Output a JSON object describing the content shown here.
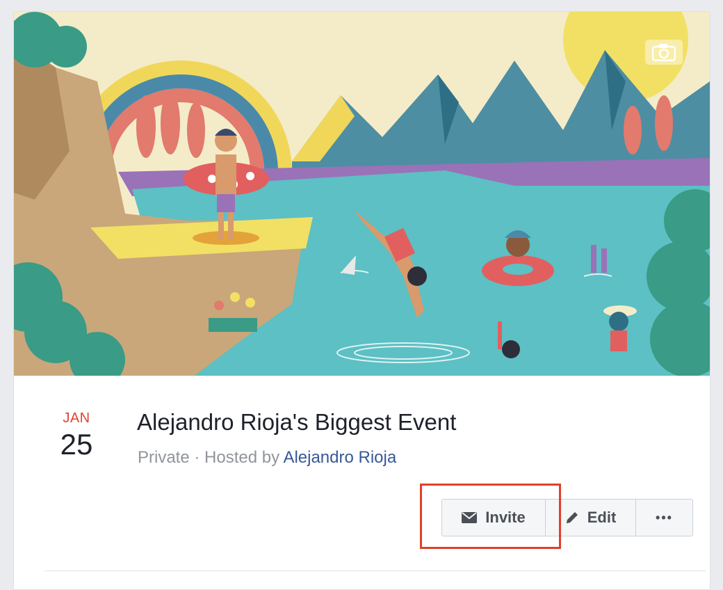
{
  "event": {
    "date_month": "JAN",
    "date_day": "25",
    "title": "Alejandro Rioja's Biggest Event",
    "privacy": "Private",
    "separator": " · ",
    "hosted_by_prefix": "Hosted by ",
    "host_name": "Alejandro Rioja"
  },
  "actions": {
    "invite_label": "Invite",
    "edit_label": "Edit",
    "more_label": "•••"
  },
  "icons": {
    "camera": "camera-icon",
    "invite": "envelope-icon",
    "edit": "pencil-icon",
    "more": "ellipsis-icon"
  },
  "colors": {
    "month": "#e4412c",
    "host_link": "#365899",
    "highlight": "#e0402b",
    "lake": "#5cc0c4",
    "sky": "#f4ecc8"
  }
}
